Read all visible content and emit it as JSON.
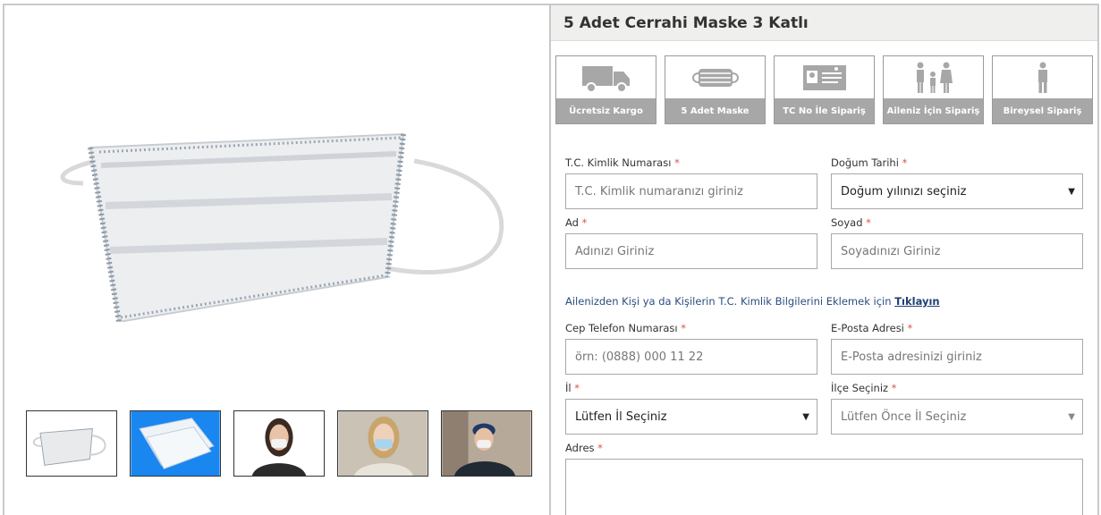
{
  "product": {
    "title": "5 Adet Cerrahi Maske 3 Katlı"
  },
  "gallery": {
    "thumbnails": [
      "mask-photo",
      "mask-stack-photo",
      "woman-mask-photo",
      "woman-blue-mask-photo",
      "man-mask-photo"
    ]
  },
  "features": [
    {
      "icon": "truck-icon",
      "label": "Ücretsiz Kargo"
    },
    {
      "icon": "mask-icon",
      "label": "5 Adet Maske"
    },
    {
      "icon": "id-card-icon",
      "label": "TC No İle Sipariş"
    },
    {
      "icon": "family-icon",
      "label": "Aileniz İçin Sipariş"
    },
    {
      "icon": "person-icon",
      "label": "Bireysel Sipariş"
    }
  ],
  "form": {
    "tc": {
      "label": "T.C. Kimlik Numarası",
      "placeholder": "T.C. Kimlik numaranızı giriniz"
    },
    "birth": {
      "label": "Doğum Tarihi",
      "value": "Doğum yılınızı seçiniz"
    },
    "name": {
      "label": "Ad",
      "placeholder": "Adınızı Giriniz"
    },
    "surname": {
      "label": "Soyad",
      "placeholder": "Soyadınızı Giriniz"
    },
    "info_text": "Ailenizden Kişi ya da Kişilerin T.C. Kimlik Bilgilerini Eklemek için",
    "info_link": "Tıklayın",
    "phone": {
      "label": "Cep Telefon Numarası",
      "placeholder": "örn: (0888) 000 11 22"
    },
    "email": {
      "label": "E-Posta Adresi",
      "placeholder": "E-Posta adresinizi giriniz"
    },
    "city": {
      "label": "İl",
      "value": "Lütfen İl Seçiniz"
    },
    "district": {
      "label": "İlçe Seçiniz",
      "value": "Lütfen Önce İl Seçiniz"
    },
    "address": {
      "label": "Adres"
    },
    "required_mark": "*",
    "caret": "▼"
  },
  "colors": {
    "feature_label_bg": "#a7a7a7",
    "required": "#d9534f",
    "link": "#1e3f73"
  }
}
